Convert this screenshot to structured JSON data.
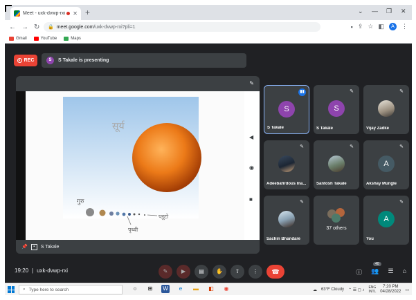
{
  "browser": {
    "tab_title": "Meet - uxk-dvwp-rxi",
    "new_tab": "+",
    "url": "meet.google.com/uxk-dvwp-rxi?pli=1",
    "url_domain": "meet.google.com",
    "url_path": "/uxk-dvwp-rxi?pli=1",
    "profile_initial": "A",
    "bookmarks": [
      {
        "label": "Gmail",
        "color": "#ea4335"
      },
      {
        "label": "YouTube",
        "color": "#ff0000"
      },
      {
        "label": "Maps",
        "color": "#34a853"
      }
    ]
  },
  "meet": {
    "rec_label": "REC",
    "presenter_initial": "S",
    "presenting_text": "S Takale is presenting",
    "stage_footer_name": "S Takale",
    "slide": {
      "title_hi": "सूर्य",
      "label_guru": "गुरु",
      "label_prithvi": "पृथ्वी",
      "label_pluto": "प्लूटो"
    },
    "participants": [
      {
        "name": "S Takale",
        "initial": "S",
        "color": "#8e44ad",
        "state": "speaking"
      },
      {
        "name": "S Takale",
        "initial": "S",
        "color": "#8e44ad",
        "state": "muted"
      },
      {
        "name": "Vijay Zadke",
        "initial": "",
        "color": "",
        "state": "muted",
        "photo": true
      },
      {
        "name": "Adeebafirdous Ina...",
        "initial": "",
        "color": "",
        "state": "muted",
        "photo": true
      },
      {
        "name": "Santosh Takale",
        "initial": "",
        "color": "",
        "state": "muted",
        "photo": true
      },
      {
        "name": "Akshay Mungle",
        "initial": "A",
        "color": "#455a64",
        "state": "muted"
      },
      {
        "name": "Sachin Bhandare",
        "initial": "",
        "color": "",
        "state": "muted",
        "photo": true
      },
      {
        "name": "",
        "initial": "",
        "color": "",
        "state": "none",
        "others": "37 others"
      },
      {
        "name": "You",
        "initial": "A",
        "color": "#00897b",
        "state": "muted"
      }
    ],
    "time": "19:20",
    "meeting_code": "uxk-dvwp-rxi",
    "people_count": "40"
  },
  "taskbar": {
    "search_placeholder": "Type here to search",
    "weather": "63°F  Cloudy",
    "lang_top": "ENG",
    "lang_bottom": "INTL",
    "time": "7:20 PM",
    "date": "04/28/2022"
  }
}
